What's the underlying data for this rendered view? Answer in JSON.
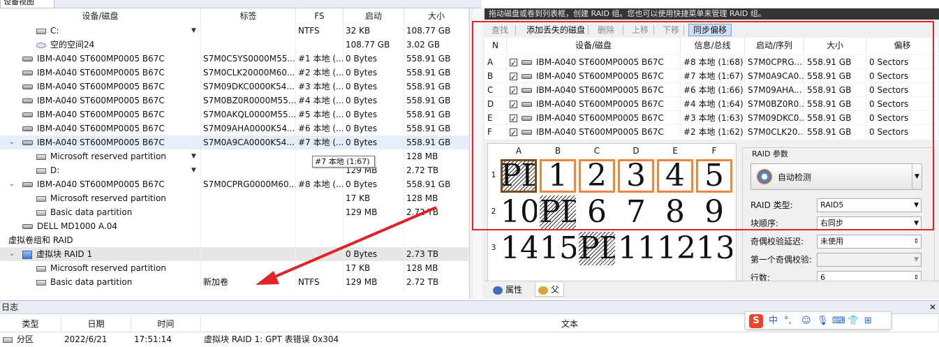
{
  "tab": {
    "label": "设备视图"
  },
  "left": {
    "headers": [
      "设备/磁盘",
      "标签",
      "FS",
      "启动",
      "大小"
    ],
    "rows": [
      {
        "indent": 2,
        "icon": "partition",
        "name": "C:",
        "has_dd": true,
        "label": "",
        "fs": "NTFS",
        "start": "32 KB",
        "size": "108.77 GB"
      },
      {
        "indent": 2,
        "icon": "space",
        "name": "空的空间24",
        "has_dd": false,
        "label": "",
        "fs": "",
        "start": "108.77 GB",
        "size": "3.02 GB"
      },
      {
        "indent": 1,
        "icon": "disk",
        "name": "IBM-A040 ST600MP0005 B67C",
        "label": "S7M0C5YS0000M55...",
        "fs": "#1 本地 (...",
        "start": "0 Bytes",
        "size": "558.91 GB"
      },
      {
        "indent": 1,
        "icon": "disk",
        "name": "IBM-A040 ST600MP0005 B67C",
        "label": "S7M0CLK20000M60...",
        "fs": "#2 本地 (...",
        "start": "0 Bytes",
        "size": "558.91 GB"
      },
      {
        "indent": 1,
        "icon": "disk",
        "name": "IBM-A040 ST600MP0005 B67C",
        "label": "S7M09DKC0000K54...",
        "fs": "#3 本地 (...",
        "start": "0 Bytes",
        "size": "558.91 GB"
      },
      {
        "indent": 1,
        "icon": "disk",
        "name": "IBM-A040 ST600MP0005 B67C",
        "label": "S7M0BZ0R0000M55...",
        "fs": "#4 本地 (...",
        "start": "0 Bytes",
        "size": "558.91 GB"
      },
      {
        "indent": 1,
        "icon": "disk",
        "name": "IBM-A040 ST600MP0005 B67C",
        "label": "S7M0AKQL0000M55...",
        "fs": "#5 本地 (...",
        "start": "0 Bytes",
        "size": "558.91 GB"
      },
      {
        "indent": 1,
        "icon": "disk",
        "name": "IBM-A040 ST600MP0005 B67C",
        "label": "S7M09AHA0000K54...",
        "fs": "#6 本地 (...",
        "start": "0 Bytes",
        "size": "558.91 GB"
      },
      {
        "indent": 1,
        "icon": "disk",
        "expand": "⌄",
        "selected": true,
        "name": "IBM-A040 ST600MP0005 B67C",
        "label": "S7M0A9CA0000K54...",
        "fs": "#7 本地 (...",
        "start": "0 Bytes",
        "size": "558.91 GB"
      },
      {
        "indent": 2,
        "icon": "partition",
        "name": "Microsoft reserved partition",
        "has_dd": true,
        "label": "",
        "fs": "",
        "start": "",
        "size": "128 MB"
      },
      {
        "indent": 2,
        "icon": "partition",
        "name": "D:",
        "has_dd": true,
        "label": "",
        "fs": "",
        "start": "129 MB",
        "size": "2.72 TB"
      },
      {
        "indent": 1,
        "icon": "disk",
        "expand": "⌄",
        "name": "IBM-A040 ST600MP0005 B67C",
        "label": "S7M0CPRG0000M60...",
        "fs": "#8 本地 (...",
        "start": "0 Bytes",
        "size": "558.91 GB"
      },
      {
        "indent": 2,
        "icon": "partition",
        "name": "Microsoft reserved partition",
        "label": "",
        "fs": "",
        "start": "17 KB",
        "size": "128 MB"
      },
      {
        "indent": 2,
        "icon": "partition",
        "name": "Basic data partition",
        "label": "",
        "fs": "",
        "start": "129 MB",
        "size": "2.72 TB"
      },
      {
        "indent": 1,
        "icon": "disk",
        "name": "DELL MD1000 A.04",
        "label": "",
        "fs": "",
        "start": "",
        "size": ""
      },
      {
        "indent": 0,
        "icon": "none",
        "expand": "⌄",
        "name": "虚拟卷组和 RAID",
        "label": "",
        "fs": "",
        "start": "",
        "size": ""
      },
      {
        "indent": 1,
        "icon": "raid",
        "expand": "⌄",
        "group": true,
        "name": "虚拟块 RAID 1",
        "label": "",
        "fs": "",
        "start": "0 Bytes",
        "size": "2.73 TB"
      },
      {
        "indent": 2,
        "icon": "partition",
        "name": "Microsoft reserved partition",
        "label": "",
        "fs": "",
        "start": "17 KB",
        "size": "128 MB"
      },
      {
        "indent": 2,
        "icon": "partition",
        "name": "Basic data partition",
        "label": "新加卷",
        "fs": "NTFS",
        "start": "129 MB",
        "size": "2.72 TB"
      }
    ]
  },
  "tooltip": "#7 本地 (1:67)",
  "right": {
    "hint": "拖动磁盘或卷到列表框，创建 RAID 组。您也可以使用快捷菜单来管理 RAID 组。",
    "toolbar": [
      {
        "label": "查找",
        "state": "disabled"
      },
      {
        "label": "添加丢失的磁盘",
        "state": "normal"
      },
      {
        "label": "删除",
        "state": "disabled"
      },
      {
        "label": "上移",
        "state": "disabled"
      },
      {
        "label": "下移",
        "state": "disabled"
      },
      {
        "label": "同步偏移",
        "state": "active"
      }
    ],
    "headers": [
      "N",
      "设备/磁盘",
      "信息/总线",
      "启动/序列",
      "大小",
      "偏移"
    ],
    "rows": [
      {
        "n": "A",
        "name": "IBM-A040 ST600MP0005 B67C",
        "info": "#8 本地 (1:68)",
        "serial": "S7M0CPRG...",
        "size": "558.91 GB",
        "offset": "0 Sectors"
      },
      {
        "n": "B",
        "name": "IBM-A040 ST600MP0005 B67C",
        "info": "#7 本地 (1:67)",
        "serial": "S7M0A9CA0...",
        "size": "558.91 GB",
        "offset": "0 Sectors"
      },
      {
        "n": "C",
        "name": "IBM-A040 ST600MP0005 B67C",
        "info": "#6 本地 (1:66)",
        "serial": "S7M09AHA...",
        "size": "558.91 GB",
        "offset": "0 Sectors"
      },
      {
        "n": "D",
        "name": "IBM-A040 ST600MP0005 B67C",
        "info": "#4 本地 (1:64)",
        "serial": "S7M0BZ0R0...",
        "size": "558.91 GB",
        "offset": "0 Sectors"
      },
      {
        "n": "E",
        "name": "IBM-A040 ST600MP0005 B67C",
        "info": "#3 本地 (1:63)",
        "serial": "S7M09DKC0...",
        "size": "558.91 GB",
        "offset": "0 Sectors"
      },
      {
        "n": "F",
        "name": "IBM-A040 ST600MP0005 B67C",
        "info": "#2 本地 (1:62)",
        "serial": "S7M0CLK20...",
        "size": "558.91 GB",
        "offset": "0 Sectors"
      }
    ],
    "matrix": {
      "cols": [
        "A",
        "B",
        "C",
        "D",
        "E",
        "F"
      ],
      "row_labels": [
        "1",
        "2",
        "3"
      ],
      "cells": [
        [
          {
            "t": "PD",
            "pd": true,
            "hl": "dark"
          },
          {
            "t": "1",
            "hl": "orange"
          },
          {
            "t": "2",
            "hl": "orange"
          },
          {
            "t": "3",
            "hl": "orange"
          },
          {
            "t": "4",
            "hl": "orange"
          },
          {
            "t": "5",
            "hl": "orange"
          }
        ],
        [
          {
            "t": "10"
          },
          {
            "t": "PD",
            "pd": true
          },
          {
            "t": "6"
          },
          {
            "t": "7"
          },
          {
            "t": "8"
          },
          {
            "t": "9"
          }
        ],
        [
          {
            "t": "14"
          },
          {
            "t": "15"
          },
          {
            "t": "PD",
            "pd": true
          },
          {
            "t": "11"
          },
          {
            "t": "12"
          },
          {
            "t": "13"
          }
        ]
      ]
    },
    "params": {
      "legend": "RAID 参数",
      "auto_detect": "自动检测",
      "fields": [
        {
          "label": "RAID 类型:",
          "value": "RAID5",
          "kind": "select"
        },
        {
          "label": "块顺序:",
          "value": "右同步",
          "kind": "select"
        },
        {
          "label": "奇偶校验延迟:",
          "value": "未使用",
          "kind": "spin"
        },
        {
          "label": "第一个奇偶校验:",
          "value": "",
          "kind": "disabled"
        },
        {
          "label": "行数:",
          "value": "6",
          "kind": "spin"
        }
      ]
    },
    "bottom_tabs": [
      "属性",
      "父"
    ]
  },
  "log": {
    "title": "日志",
    "close": "✕",
    "headers": [
      "类型",
      "日期",
      "时间",
      "文本"
    ],
    "row": {
      "type": "分区",
      "date": "2022/6/21",
      "time": "17:51:14",
      "text": "虚拟块 RAID 1: GPT 表错误 0x304"
    }
  },
  "ime": {
    "logo": "S",
    "lang": "中",
    "punct": "°,",
    "icons": [
      "smile-icon",
      "mic-icon",
      "keyboard-icon",
      "shirt-icon",
      "grid-icon"
    ]
  },
  "colors": {
    "annotation_red": "#e0242a",
    "highlight_orange": "#f0883c"
  }
}
